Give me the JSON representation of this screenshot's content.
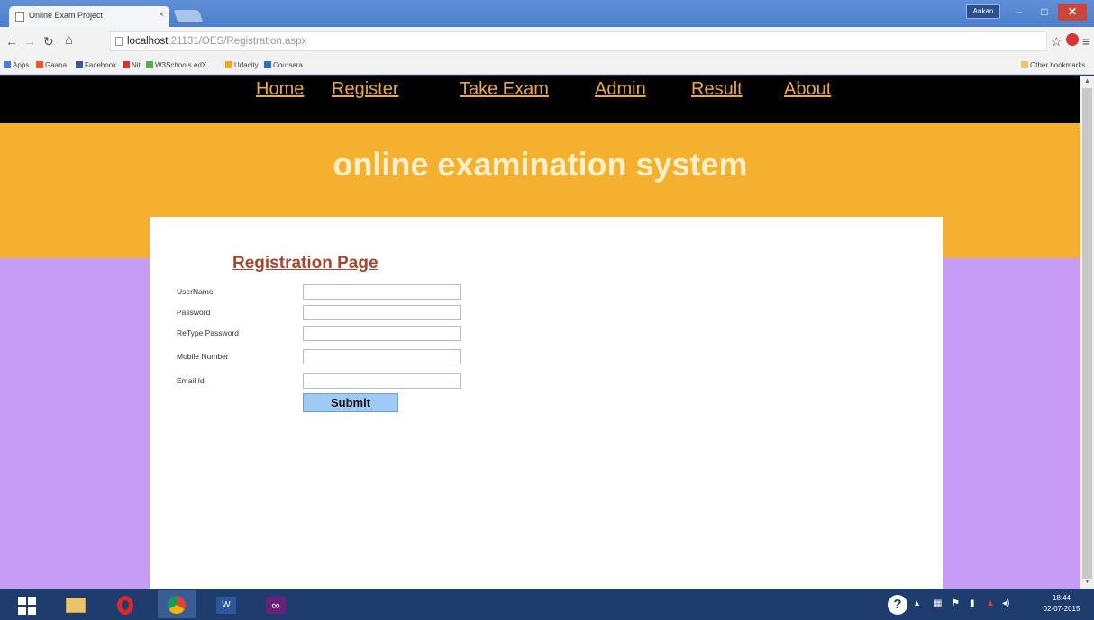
{
  "browser": {
    "tab_title": "Online Exam Project",
    "tab_close": "×",
    "user_badge": "Ankan",
    "min_glyph": "–",
    "max_glyph": "□",
    "close_glyph": "✕",
    "url_host": "localhost",
    "url_rest": ":21131/OES/Registration.aspx",
    "bookmarks": [
      "Apps",
      "Gaana",
      "Facebook",
      "Nit",
      "W3Schools",
      "edX",
      "Udacity",
      "Coursera"
    ],
    "other_bookmarks": "Other bookmarks"
  },
  "site": {
    "menu": [
      "Home",
      "Register",
      "Take Exam",
      "Admin",
      "Result",
      "About"
    ],
    "title": "online examination system"
  },
  "form": {
    "heading": "Registration Page",
    "fields": [
      {
        "label": "UserName",
        "value": ""
      },
      {
        "label": "Password",
        "value": ""
      },
      {
        "label": "ReType Password",
        "value": ""
      },
      {
        "label": "Mobile Number",
        "value": ""
      },
      {
        "label": "Email Id",
        "value": ""
      }
    ],
    "submit_label": "Submit"
  },
  "taskbar": {
    "time": "18:44",
    "date": "02-07-2015",
    "help_glyph": "?"
  },
  "colors": {
    "menu_bg": "#000000",
    "menu_link": "#e8a948",
    "banner": "#f6b030",
    "side": "#c79cf5",
    "heading": "#a5472c",
    "submit": "#9fcaf5"
  }
}
